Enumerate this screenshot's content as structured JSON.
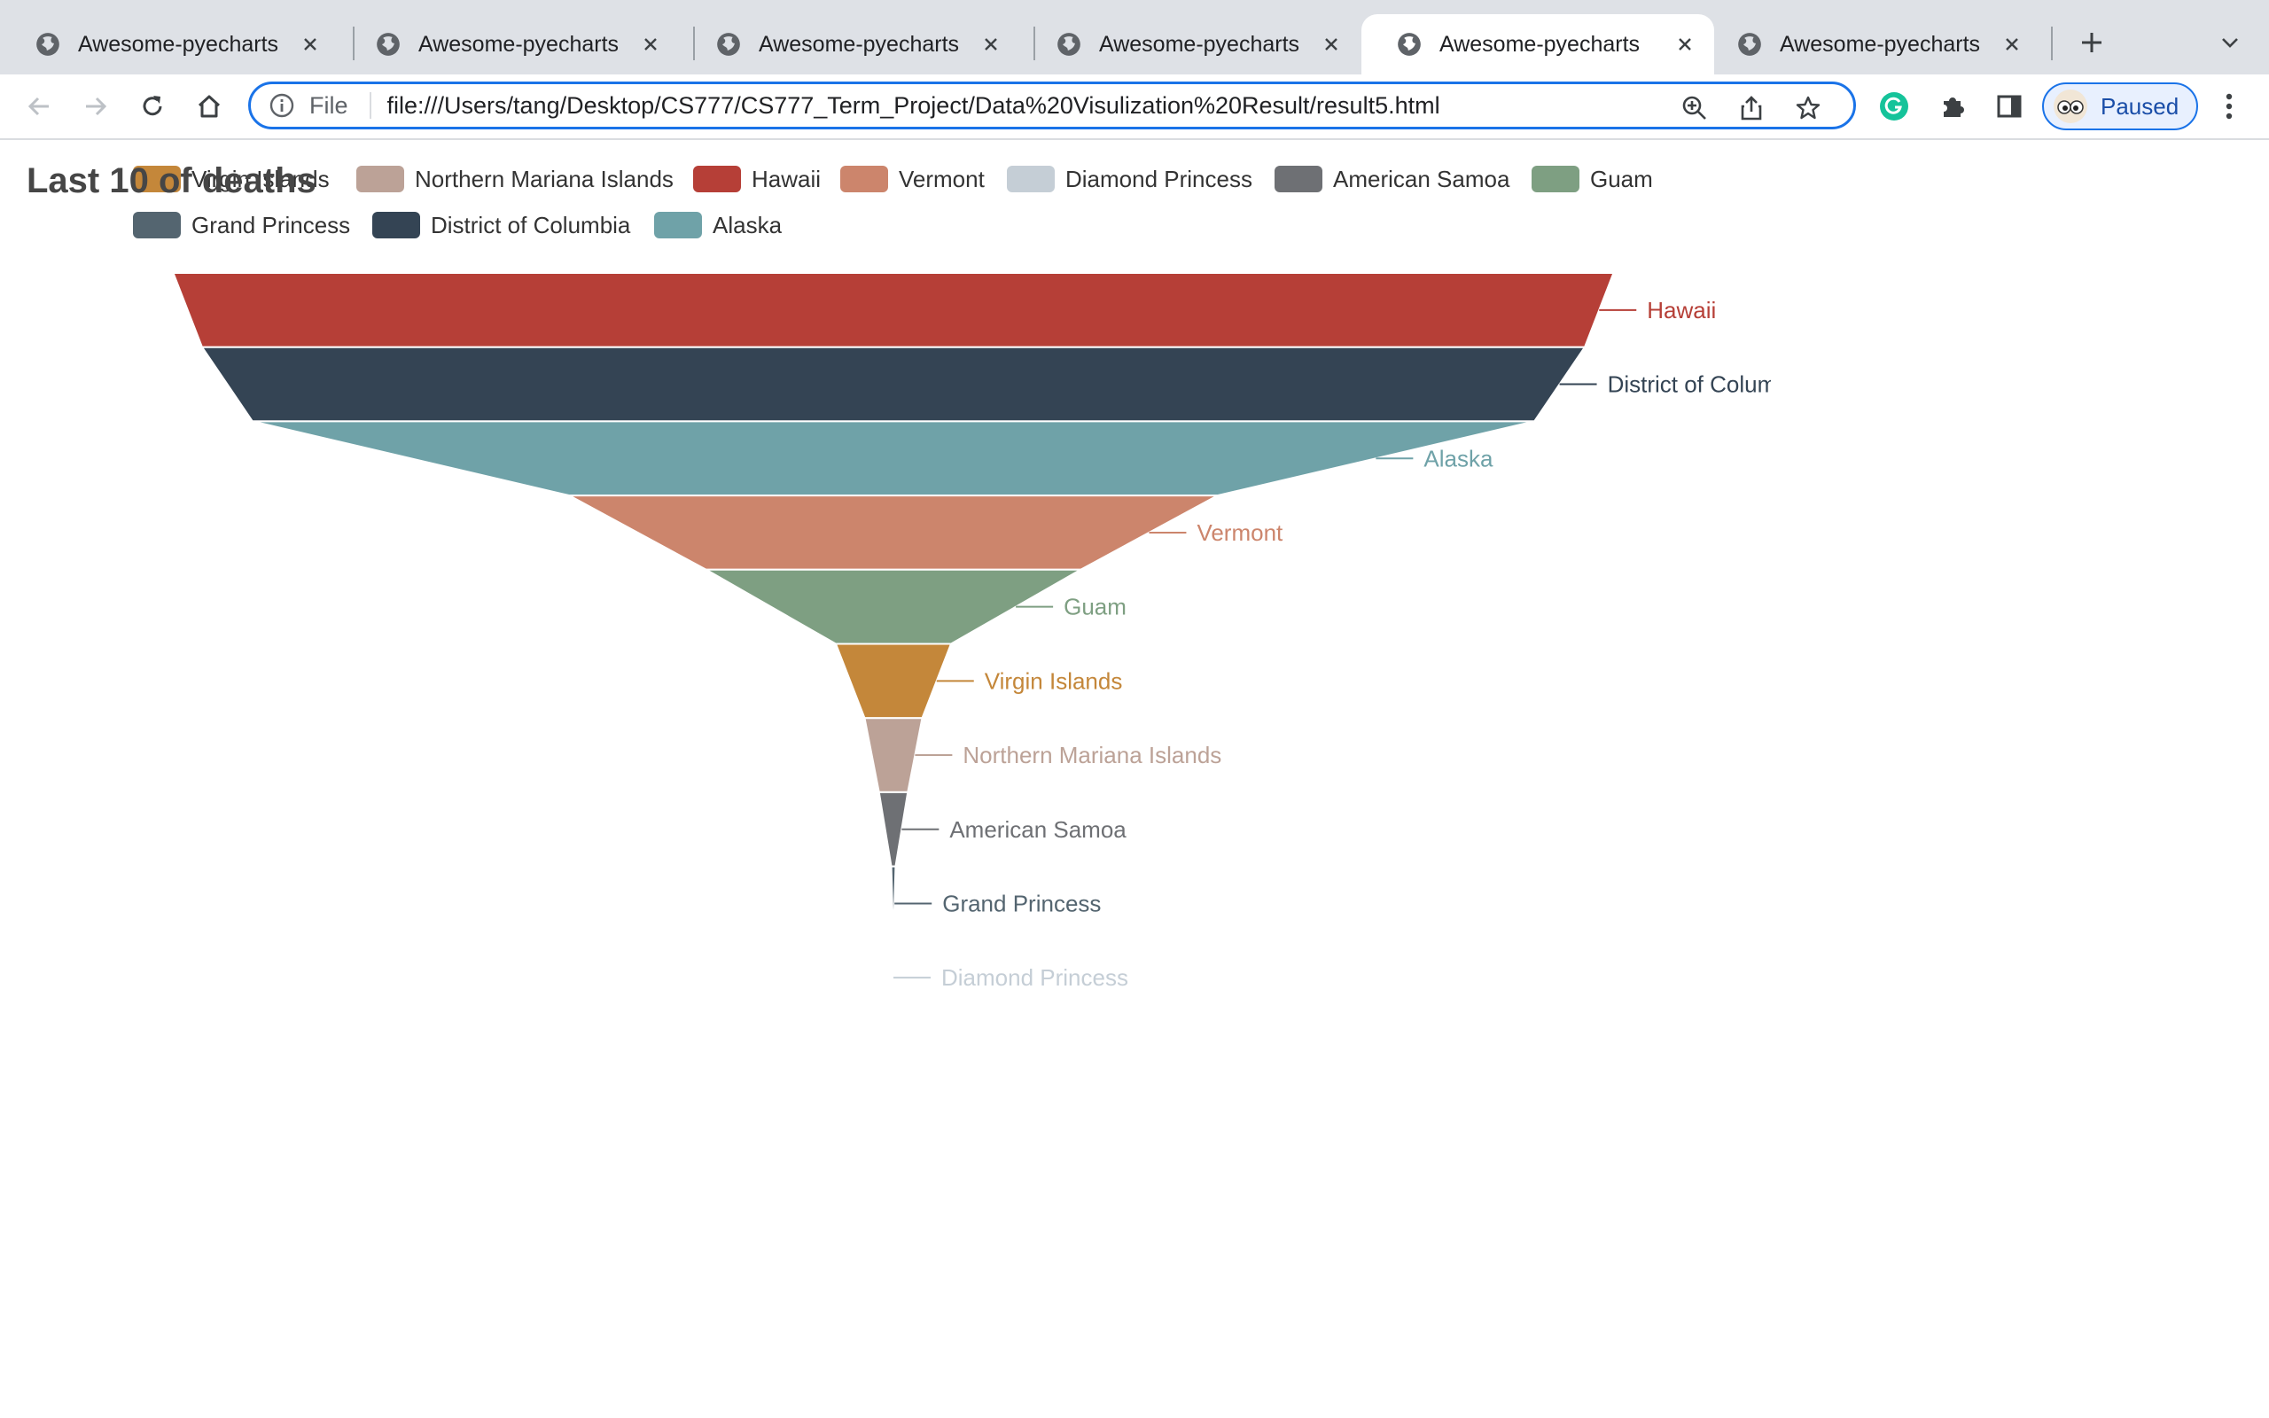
{
  "browser": {
    "tabs": [
      {
        "title": "Awesome-pyecharts",
        "active": false
      },
      {
        "title": "Awesome-pyecharts",
        "active": false
      },
      {
        "title": "Awesome-pyecharts",
        "active": false
      },
      {
        "title": "Awesome-pyecharts",
        "active": false
      },
      {
        "title": "Awesome-pyecharts",
        "active": true
      },
      {
        "title": "Awesome-pyecharts",
        "active": false
      }
    ],
    "omnibox": {
      "chip": "File",
      "url": "file:///Users/tang/Desktop/CS777/CS777_Term_Project/Data%20Visulization%20Result/result5.html"
    },
    "profile": {
      "label": "Paused"
    }
  },
  "page": {
    "title": "Last 10 of deaths"
  },
  "legend": [
    {
      "label": "Virgin Islands",
      "color": "#c4873a"
    },
    {
      "label": "Northern Mariana Islands",
      "color": "#bca297"
    },
    {
      "label": "Hawaii",
      "color": "#b63f37"
    },
    {
      "label": "Vermont",
      "color": "#cc856c"
    },
    {
      "label": "Diamond Princess",
      "color": "#c5ced6"
    },
    {
      "label": "American Samoa",
      "color": "#6e7074"
    },
    {
      "label": "Guam",
      "color": "#7e9f82"
    },
    {
      "label": "Grand Princess",
      "color": "#546570"
    },
    {
      "label": "District of Columbia",
      "color": "#344454"
    },
    {
      "label": "Alaska",
      "color": "#6fa2a8"
    }
  ],
  "chart_data": {
    "type": "funnel",
    "title": "Last 10 of deaths",
    "sort": "descending",
    "label_position": "right",
    "series": [
      {
        "name": "Hawaii",
        "value": 100,
        "color": "#b63f37"
      },
      {
        "name": "District of Columbia",
        "value": 96,
        "color": "#344454"
      },
      {
        "name": "Alaska",
        "value": 89,
        "color": "#6fa2a8"
      },
      {
        "name": "Vermont",
        "value": 45,
        "color": "#cc856c"
      },
      {
        "name": "Guam",
        "value": 26,
        "color": "#7e9f82"
      },
      {
        "name": "Virgin Islands",
        "value": 8,
        "color": "#c4873a"
      },
      {
        "name": "Northern Mariana Islands",
        "value": 4,
        "color": "#bca297"
      },
      {
        "name": "American Samoa",
        "value": 2,
        "color": "#6e7074"
      },
      {
        "name": "Grand Princess",
        "value": 0.3,
        "color": "#546570"
      },
      {
        "name": "Diamond Princess",
        "value": 0,
        "color": "#c5ced6"
      }
    ]
  }
}
